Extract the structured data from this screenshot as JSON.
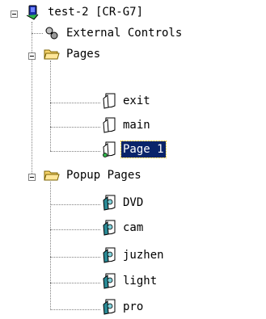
{
  "tree": {
    "root": {
      "label": "test-2 [CR-G7]",
      "icon": "system-device-icon",
      "expanded": true
    },
    "external_controls": {
      "label": "External Controls",
      "icon": "external-controls-icon"
    },
    "pages": {
      "label": "Pages",
      "icon": "folder-open-icon",
      "expanded": true,
      "items": [
        {
          "label": "exit",
          "icon": "page-icon",
          "selected": false
        },
        {
          "label": "main",
          "icon": "page-icon",
          "selected": false
        },
        {
          "label": "Page 1",
          "icon": "page-icon",
          "selected": true
        }
      ]
    },
    "popup_pages": {
      "label": "Popup Pages",
      "icon": "folder-open-icon",
      "expanded": true,
      "items": [
        {
          "label": "DVD",
          "icon": "popup-page-icon"
        },
        {
          "label": "cam",
          "icon": "popup-page-icon"
        },
        {
          "label": "juzhen",
          "icon": "popup-page-icon"
        },
        {
          "label": "light",
          "icon": "popup-page-icon"
        },
        {
          "label": "pro",
          "icon": "popup-page-icon"
        }
      ]
    }
  },
  "colors": {
    "selection_bg": "#0a246a",
    "selection_text": "#ffffff",
    "folder_yellow": "#f6d36b",
    "popup_teal": "#2a8a96",
    "device_blue": "#1a2fa8",
    "device_green": "#2fb34a"
  }
}
